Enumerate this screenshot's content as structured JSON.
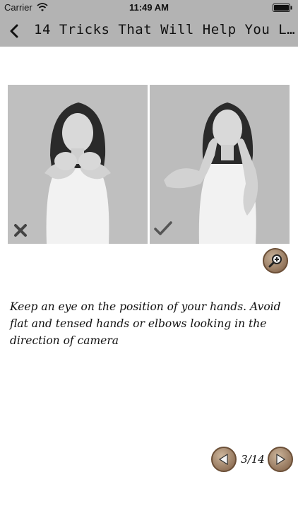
{
  "status_bar": {
    "carrier": "Carrier",
    "time": "11:49 AM"
  },
  "nav": {
    "title": "14 Tricks That Will Help You L..."
  },
  "photos": {
    "left": {
      "mark": "cross-icon"
    },
    "right": {
      "mark": "checkmark-icon"
    }
  },
  "description": "Keep an eye on the position of your hands. Avoid flat and tensed hands or elbows looking in the direction of camera",
  "pager": {
    "count": "3/14"
  }
}
